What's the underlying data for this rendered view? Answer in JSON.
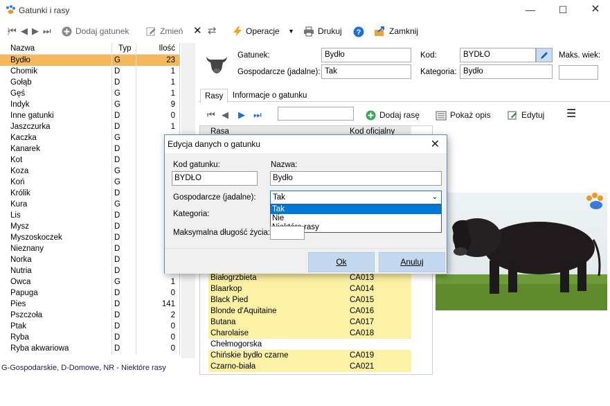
{
  "window": {
    "title": "Gatunki i rasy"
  },
  "toolbar": {
    "add_species": "Dodaj gatunek",
    "edit": "Zmień",
    "operations": "Operacje",
    "print": "Drukuj",
    "close": "Zamknij"
  },
  "species_grid": {
    "headers": {
      "name": "Nazwa",
      "type": "Typ",
      "count": "Ilość"
    },
    "rows": [
      {
        "name": "Bydło",
        "type": "G",
        "count": "23"
      },
      {
        "name": "Chomik",
        "type": "D",
        "count": "1"
      },
      {
        "name": "Gołąb",
        "type": "D",
        "count": "1"
      },
      {
        "name": "Gęś",
        "type": "G",
        "count": "1"
      },
      {
        "name": "Indyk",
        "type": "G",
        "count": "9"
      },
      {
        "name": "Inne gatunki",
        "type": "D",
        "count": "0"
      },
      {
        "name": "Jaszczurka",
        "type": "D",
        "count": "1"
      },
      {
        "name": "Kaczka",
        "type": "G",
        "count": ""
      },
      {
        "name": "Kanarek",
        "type": "D",
        "count": ""
      },
      {
        "name": "Kot",
        "type": "D",
        "count": ""
      },
      {
        "name": "Koza",
        "type": "G",
        "count": ""
      },
      {
        "name": "Koń",
        "type": "G",
        "count": ""
      },
      {
        "name": "Królik",
        "type": "D",
        "count": ""
      },
      {
        "name": "Kura",
        "type": "G",
        "count": ""
      },
      {
        "name": "Lis",
        "type": "D",
        "count": ""
      },
      {
        "name": "Mysz",
        "type": "D",
        "count": ""
      },
      {
        "name": "Myszoskoczek",
        "type": "D",
        "count": ""
      },
      {
        "name": "Nieznany",
        "type": "D",
        "count": ""
      },
      {
        "name": "Norka",
        "type": "D",
        "count": ""
      },
      {
        "name": "Nutria",
        "type": "D",
        "count": ""
      },
      {
        "name": "Owca",
        "type": "G",
        "count": "1"
      },
      {
        "name": "Papuga",
        "type": "D",
        "count": "0"
      },
      {
        "name": "Pies",
        "type": "D",
        "count": "141"
      },
      {
        "name": "Pszczoła",
        "type": "D",
        "count": "2"
      },
      {
        "name": "Ptak",
        "type": "D",
        "count": "0"
      },
      {
        "name": "Ryba",
        "type": "D",
        "count": "0"
      },
      {
        "name": "Ryba akwariowa",
        "type": "D",
        "count": "0"
      }
    ]
  },
  "status_legend": "G-Gospodarskie, D-Domowe, NR - Niektóre rasy",
  "details": {
    "species_label": "Gatunek:",
    "species_value": "Bydło",
    "code_label": "Kod:",
    "code_value": "BYDŁO",
    "max_age_label": "Maks. wiek:",
    "max_age_value": "",
    "farm_label": "Gospodarcze (jadalne):",
    "farm_value": "Tak",
    "category_label": "Kategoria:",
    "category_value": "Bydło"
  },
  "tabs": {
    "breeds": "Rasy",
    "info": "Informacje o gatunku"
  },
  "breeds_toolbar": {
    "search_value": "",
    "add_breed": "Dodaj rasę",
    "show_desc": "Pokaż opis",
    "edit": "Edytuj"
  },
  "breeds_grid": {
    "headers": {
      "breed": "Rasa",
      "code": "Kod oficjalny"
    },
    "rows": [
      {
        "name": "Białogrzbieta",
        "code": "CA013",
        "highlight": true
      },
      {
        "name": "Blaarkop",
        "code": "CA014",
        "highlight": true
      },
      {
        "name": "Black Pied",
        "code": "CA015",
        "highlight": true
      },
      {
        "name": "Blonde d'Aquitaine",
        "code": "CA016",
        "highlight": true
      },
      {
        "name": "Butana",
        "code": "CA017",
        "highlight": true
      },
      {
        "name": "Charolaise",
        "code": "CA018",
        "highlight": true
      },
      {
        "name": "Chełmogorska",
        "code": "",
        "highlight": false
      },
      {
        "name": "Chińskie bydło czarne",
        "code": "CA019",
        "highlight": true
      },
      {
        "name": "Czarno-biała",
        "code": "CA021",
        "highlight": true
      }
    ]
  },
  "dialog": {
    "title": "Edycja danych o gatunku",
    "code_label": "Kod gatunku:",
    "code_value": "BYDŁO",
    "name_label": "Nazwa:",
    "name_value": "Bydło",
    "farm_label": "Gospodarcze (jadalne):",
    "farm_selected": "Tak",
    "farm_options": [
      "Tak",
      "Nie",
      "Niektóre rasy"
    ],
    "category_label": "Kategoria:",
    "max_life_label": "Maksymalna długość życia:",
    "max_life_value": "",
    "ok": "Ok",
    "cancel": "Anuluj"
  },
  "colors": {
    "selected_row": "#f5b85c",
    "breed_highlight": "#fcf1a4",
    "dropdown_highlight": "#0078d7",
    "dialog_button": "#c4d9f0"
  }
}
